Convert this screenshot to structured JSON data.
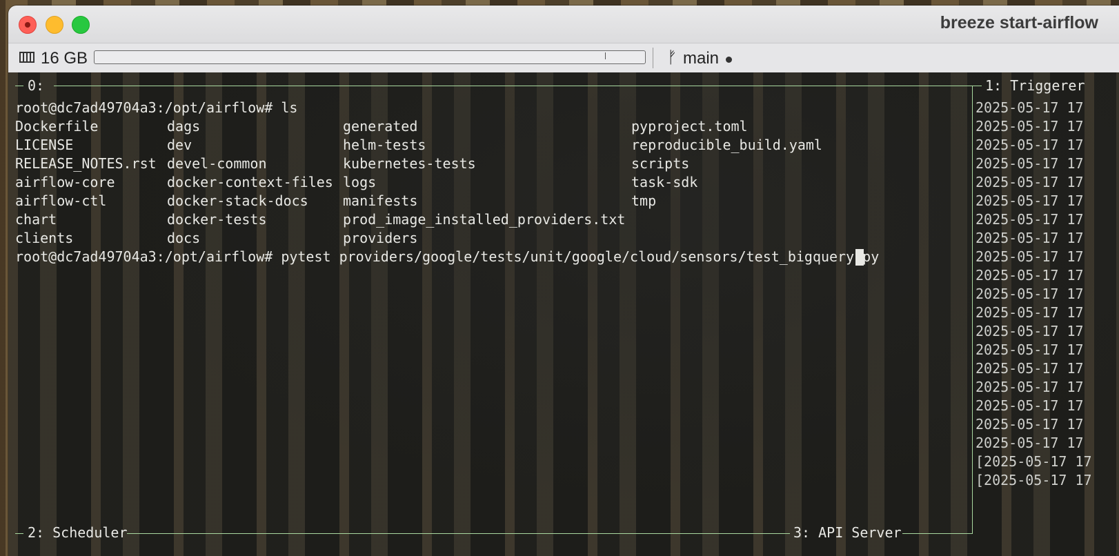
{
  "window": {
    "title": "breeze start-airflow"
  },
  "statusbar": {
    "memory_label": "16 GB",
    "memory_fill": 0.92,
    "branch_label": "main"
  },
  "panes": {
    "pane0_label": "0:",
    "pane1_label": "1: Triggerer",
    "pane2_label": "2: Scheduler",
    "pane3_label": "3: API Server"
  },
  "terminal": {
    "prompt1": "root@dc7ad49704a3:/opt/airflow# ls",
    "ls_columns": [
      [
        "Dockerfile",
        "LICENSE",
        "RELEASE_NOTES.rst",
        "airflow-core",
        "airflow-ctl",
        "chart",
        "clients"
      ],
      [
        "dags",
        "dev",
        "devel-common",
        "docker-context-files",
        "docker-stack-docs",
        "docker-tests",
        "docs"
      ],
      [
        "generated",
        "helm-tests",
        "kubernetes-tests",
        "logs",
        "manifests",
        "prod_image_installed_providers.txt",
        "providers"
      ],
      [
        "pyproject.toml",
        "reproducible_build.yaml",
        "scripts",
        "task-sdk",
        "tmp"
      ]
    ],
    "prompt2": "root@dc7ad49704a3:/opt/airflow# pytest providers/google/tests/unit/google/cloud/sensors/test_bigquery.py"
  },
  "triggerer_log": [
    "2025-05-17 17",
    "2025-05-17 17",
    "2025-05-17 17",
    "2025-05-17 17",
    "2025-05-17 17",
    "2025-05-17 17",
    "2025-05-17 17",
    "2025-05-17 17",
    "2025-05-17 17",
    "2025-05-17 17",
    "2025-05-17 17",
    "2025-05-17 17",
    "2025-05-17 17",
    "2025-05-17 17",
    "2025-05-17 17",
    "2025-05-17 17",
    "2025-05-17 17",
    "2025-05-17 17",
    "2025-05-17 17",
    "[2025-05-17 17",
    "[2025-05-17 17"
  ],
  "colors": {
    "pane_border": "#a9d9a0",
    "terminal_text": "#e8e8e4"
  }
}
